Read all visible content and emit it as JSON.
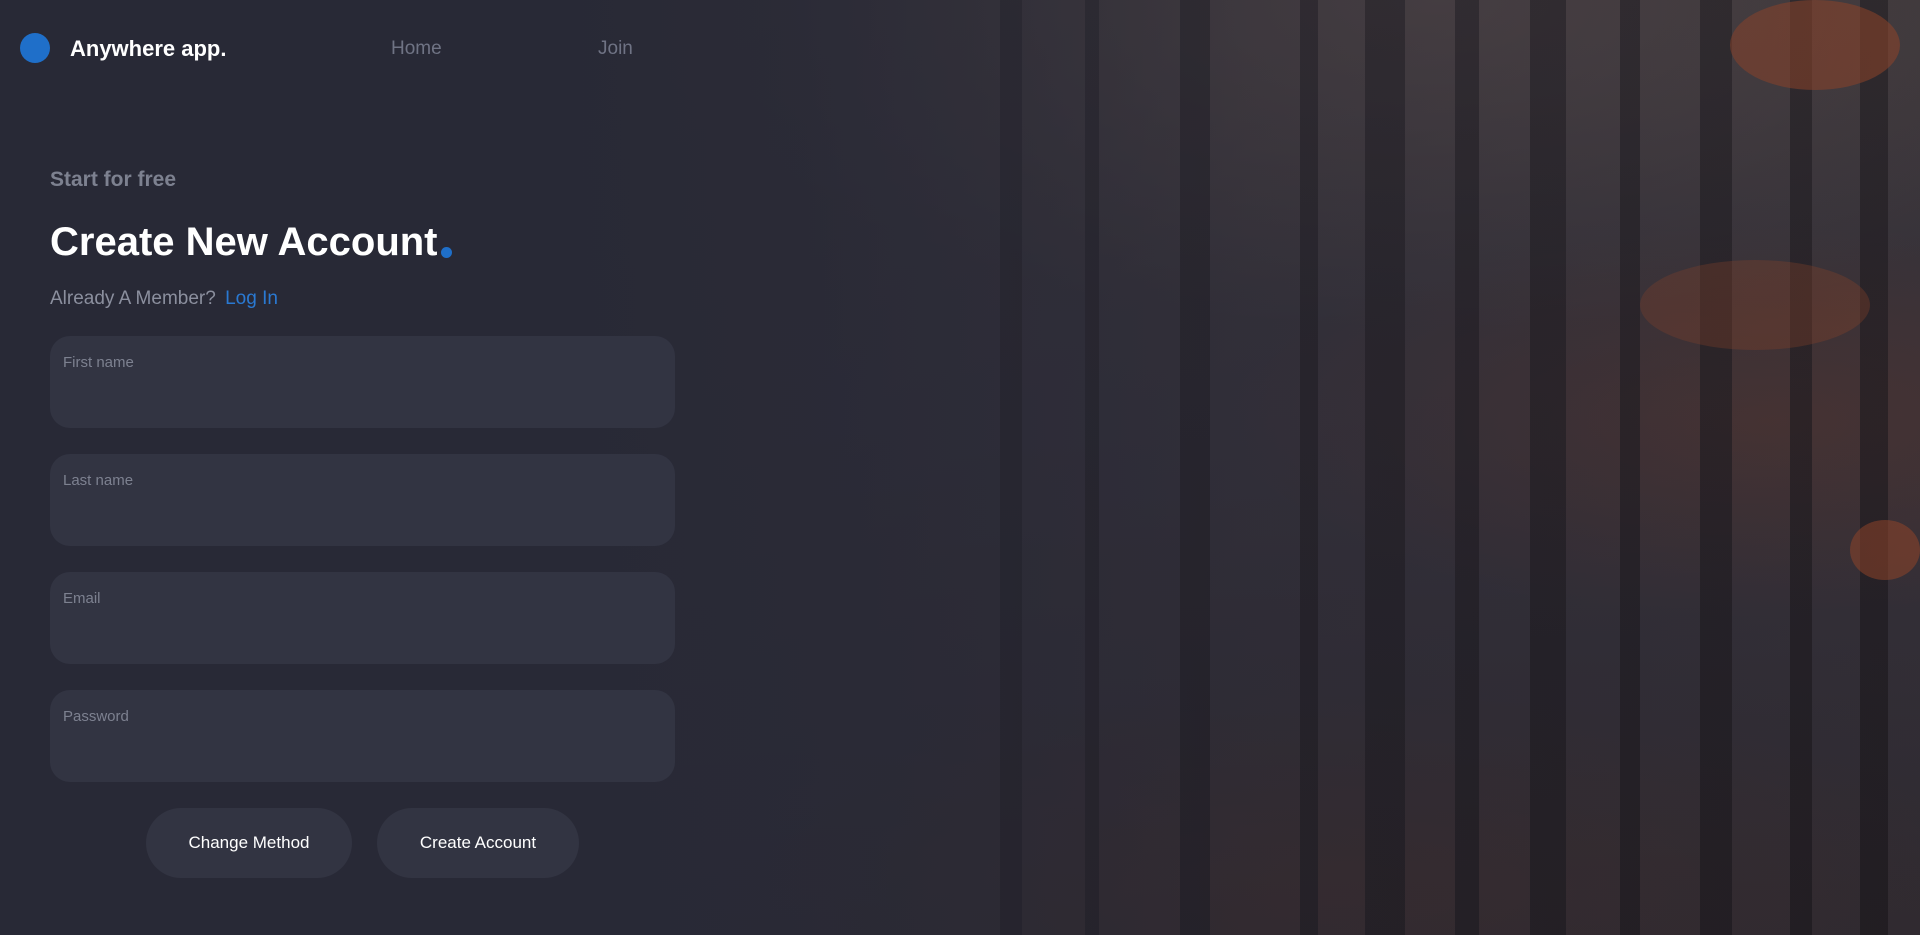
{
  "header": {
    "app_name": "Anywhere app.",
    "nav": [
      {
        "label": "Home"
      },
      {
        "label": "Join"
      }
    ]
  },
  "signup": {
    "eyebrow": "Start for free",
    "title": "Create New Account",
    "member_text": "Already A Member?",
    "login_label": "Log In",
    "fields": [
      {
        "label": "First name",
        "value": ""
      },
      {
        "label": "Last name",
        "value": ""
      },
      {
        "label": "Email",
        "value": ""
      },
      {
        "label": "Password",
        "value": ""
      }
    ],
    "buttons": {
      "change_method": "Change Method",
      "create_account": "Create Account"
    }
  },
  "colors": {
    "accent": "#1f6fc9",
    "link": "#2a79d2",
    "background": "#282936",
    "field_background": "#323442",
    "muted_text": "#7d8190"
  },
  "icons": {
    "logo": "logo-dot-icon",
    "title_accent": "accent-dot-icon"
  }
}
